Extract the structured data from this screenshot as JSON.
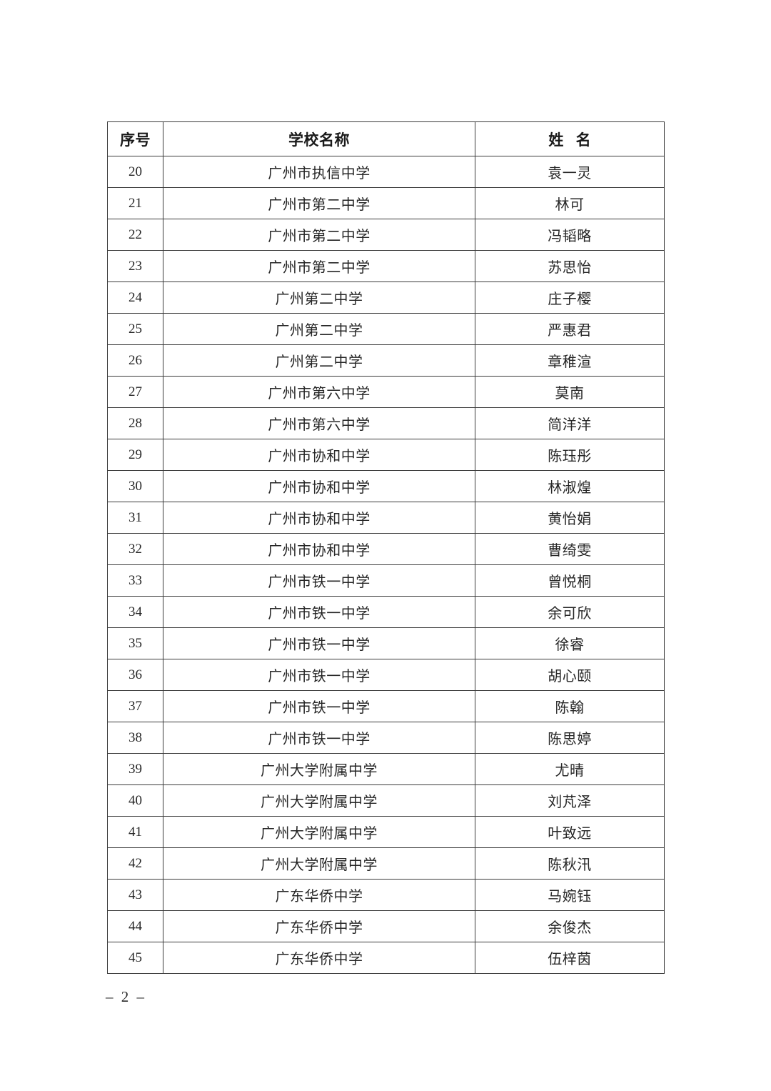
{
  "document": {
    "page_number_label": "– 2 –"
  },
  "table": {
    "columns": [
      "序号",
      "学校名称",
      "姓 名"
    ],
    "rows": [
      {
        "index": "20",
        "school": "广州市执信中学",
        "name": "袁一灵"
      },
      {
        "index": "21",
        "school": "广州市第二中学",
        "name": "林可"
      },
      {
        "index": "22",
        "school": "广州市第二中学",
        "name": "冯韬略"
      },
      {
        "index": "23",
        "school": "广州市第二中学",
        "name": "苏思怡"
      },
      {
        "index": "24",
        "school": "广州第二中学",
        "name": "庄子樱"
      },
      {
        "index": "25",
        "school": "广州第二中学",
        "name": "严惠君"
      },
      {
        "index": "26",
        "school": "广州第二中学",
        "name": "章稚渲"
      },
      {
        "index": "27",
        "school": "广州市第六中学",
        "name": "莫南"
      },
      {
        "index": "28",
        "school": "广州市第六中学",
        "name": "简洋洋"
      },
      {
        "index": "29",
        "school": "广州市协和中学",
        "name": "陈珏彤"
      },
      {
        "index": "30",
        "school": "广州市协和中学",
        "name": "林淑煌"
      },
      {
        "index": "31",
        "school": "广州市协和中学",
        "name": "黄怡娟"
      },
      {
        "index": "32",
        "school": "广州市协和中学",
        "name": "曹绮雯"
      },
      {
        "index": "33",
        "school": "广州市铁一中学",
        "name": "曾悦桐"
      },
      {
        "index": "34",
        "school": "广州市铁一中学",
        "name": "余可欣"
      },
      {
        "index": "35",
        "school": "广州市铁一中学",
        "name": "徐睿"
      },
      {
        "index": "36",
        "school": "广州市铁一中学",
        "name": "胡心颐"
      },
      {
        "index": "37",
        "school": "广州市铁一中学",
        "name": "陈翰"
      },
      {
        "index": "38",
        "school": "广州市铁一中学",
        "name": "陈思婷"
      },
      {
        "index": "39",
        "school": "广州大学附属中学",
        "name": "尤晴"
      },
      {
        "index": "40",
        "school": "广州大学附属中学",
        "name": "刘芃泽"
      },
      {
        "index": "41",
        "school": "广州大学附属中学",
        "name": "叶致远"
      },
      {
        "index": "42",
        "school": "广州大学附属中学",
        "name": "陈秋汛"
      },
      {
        "index": "43",
        "school": "广东华侨中学",
        "name": "马婉钰"
      },
      {
        "index": "44",
        "school": "广东华侨中学",
        "name": "余俊杰"
      },
      {
        "index": "45",
        "school": "广东华侨中学",
        "name": "伍梓茵"
      }
    ]
  }
}
